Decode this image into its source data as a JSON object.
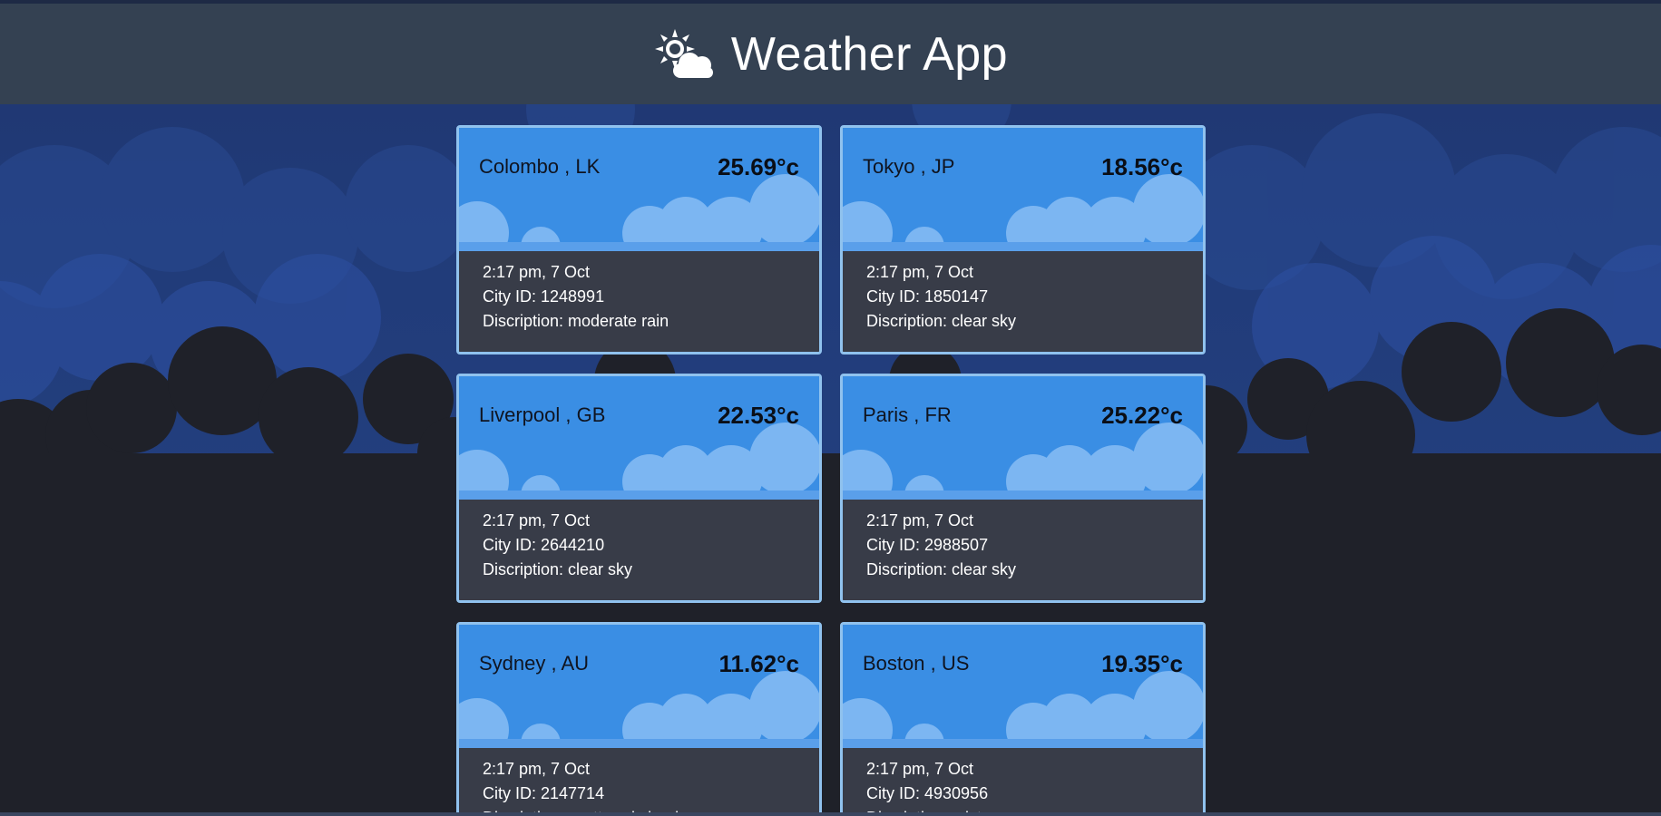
{
  "app": {
    "title": "Weather App",
    "logo_icon": "sun-cloud-icon"
  },
  "cards": [
    {
      "city": "Colombo , LK",
      "temp": "25.69°c",
      "time": "2:17 pm, 7 Oct",
      "city_id": "City ID: 1248991",
      "description": "Discription: moderate rain"
    },
    {
      "city": "Tokyo , JP",
      "temp": "18.56°c",
      "time": "2:17 pm, 7 Oct",
      "city_id": "City ID: 1850147",
      "description": "Discription: clear sky"
    },
    {
      "city": "Liverpool , GB",
      "temp": "22.53°c",
      "time": "2:17 pm, 7 Oct",
      "city_id": "City ID: 2644210",
      "description": "Discription: clear sky"
    },
    {
      "city": "Paris , FR",
      "temp": "25.22°c",
      "time": "2:17 pm, 7 Oct",
      "city_id": "City ID: 2988507",
      "description": "Discription: clear sky"
    },
    {
      "city": "Sydney , AU",
      "temp": "11.62°c",
      "time": "2:17 pm, 7 Oct",
      "city_id": "City ID: 2147714",
      "description": "Discription: scattered clouds"
    },
    {
      "city": "Boston , US",
      "temp": "19.35°c",
      "time": "2:17 pm, 7 Oct",
      "city_id": "City ID: 4930956",
      "description": "Discription: mist"
    }
  ],
  "colors": {
    "header_bg": "#344152",
    "card_top": "#3a8ee4",
    "card_bottom": "#383c48",
    "card_border": "#90c2ee",
    "sky": "#213c7a",
    "ground": "#1f2129"
  }
}
